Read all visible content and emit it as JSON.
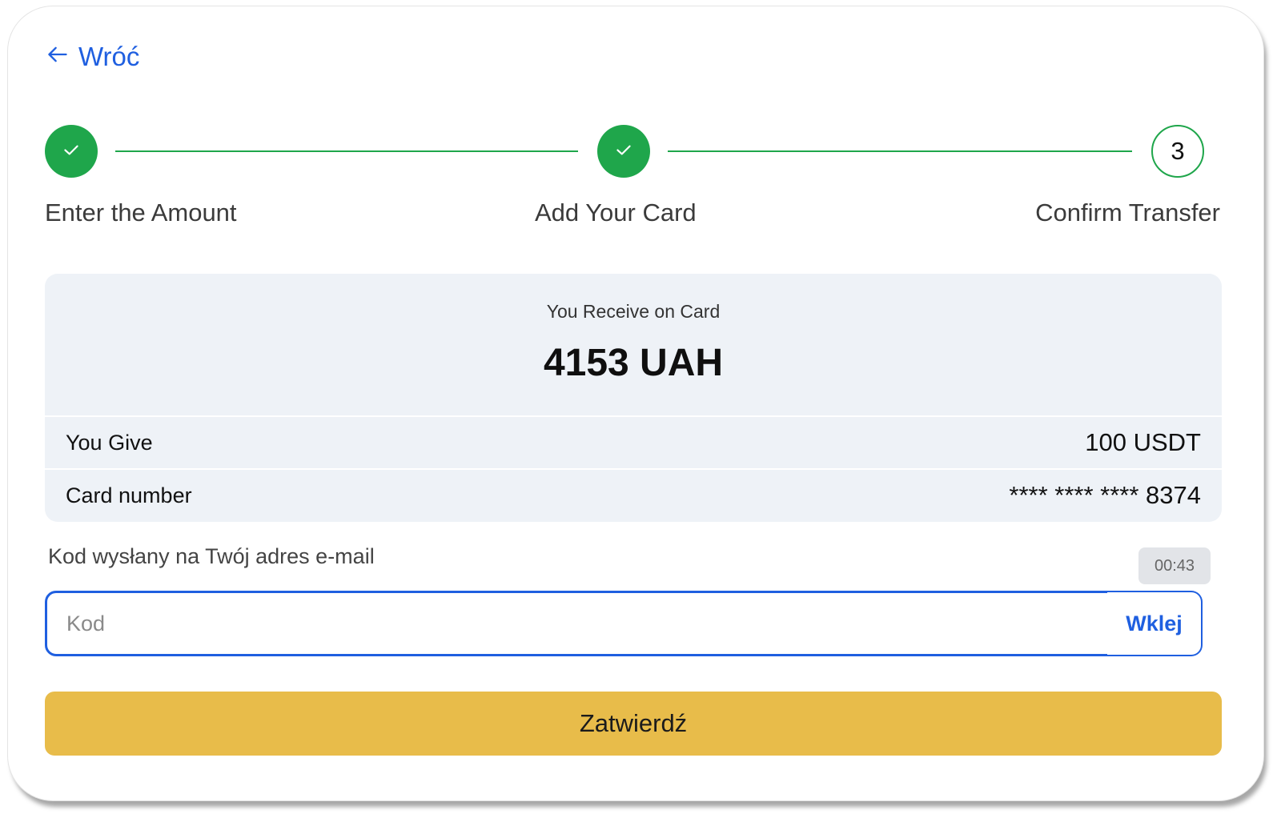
{
  "back": {
    "label": "Wróć",
    "icon": "arrow-left-icon"
  },
  "steps": [
    {
      "label": "Enter the Amount",
      "status": "completed",
      "icon": "check-icon"
    },
    {
      "label": "Add Your Card",
      "status": "completed",
      "icon": "check-icon"
    },
    {
      "label": "Confirm Transfer",
      "status": "current",
      "number": "3"
    }
  ],
  "summary": {
    "receive_label": "You Receive on Card",
    "receive_amount": "4153 UAH",
    "rows": [
      {
        "key": "You Give",
        "value": "100 USDT"
      },
      {
        "key": "Card number",
        "value": "**** **** **** 8374"
      }
    ]
  },
  "verification": {
    "label": "Kod wysłany na Twój adres e-mail",
    "timer": "00:43",
    "input_placeholder": "Kod",
    "input_value": "",
    "paste_label": "Wklej"
  },
  "confirm_label": "Zatwierdź",
  "colors": {
    "accent_blue": "#1f5fe0",
    "success_green": "#1fa64b",
    "confirm_yellow": "#e8bc4a",
    "summary_bg": "#eef2f7"
  }
}
